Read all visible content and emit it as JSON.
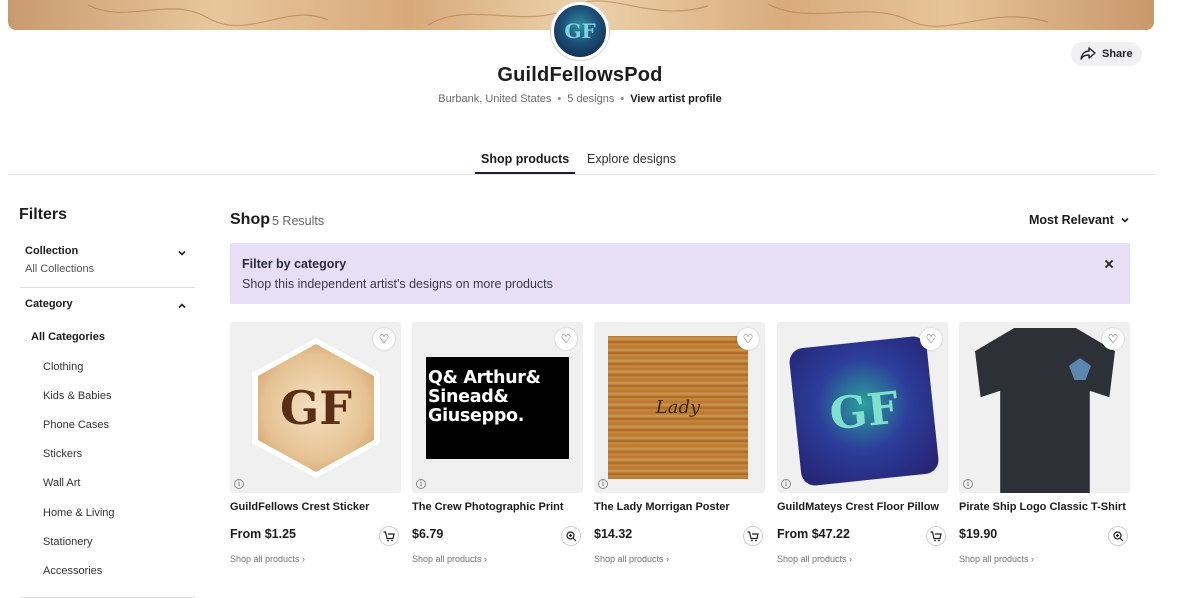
{
  "artist": {
    "name": "GuildFellowsPod",
    "location": "Burbank, United States",
    "designs_count": "5 designs",
    "view_profile": "View artist profile",
    "avatar_text": "GF"
  },
  "share": {
    "label": "Share"
  },
  "tabs": [
    {
      "label": "Shop products",
      "active": true
    },
    {
      "label": "Explore designs",
      "active": false
    }
  ],
  "filters": {
    "title": "Filters",
    "collection": {
      "label": "Collection",
      "value": "All Collections"
    },
    "category": {
      "label": "Category",
      "all": "All Categories",
      "items": [
        "Clothing",
        "Kids & Babies",
        "Phone Cases",
        "Stickers",
        "Wall Art",
        "Home & Living",
        "Stationery",
        "Accessories"
      ]
    }
  },
  "shop": {
    "title": "Shop",
    "results": "5 Results",
    "sort": "Most Relevant"
  },
  "promo": {
    "title": "Filter by category",
    "text": "Shop this independent artist's designs on more products"
  },
  "products": [
    {
      "title": "GuildFellows Crest Sticker",
      "price": "From $1.25",
      "link": "Shop all products",
      "action": "add-to-cart",
      "art_text": "GF"
    },
    {
      "title": "The Crew Photographic Print",
      "price": "$6.79",
      "link": "Shop all products",
      "action": "zoom",
      "art_text": "Q& Arthur& Sinead& Giuseppo."
    },
    {
      "title": "The Lady Morrigan Poster",
      "price": "$14.32",
      "link": "Shop all products",
      "action": "add-to-cart",
      "art_text": "Lady"
    },
    {
      "title": "GuildMateys Crest Floor Pillow",
      "price": "From $47.22",
      "link": "Shop all products",
      "action": "add-to-cart",
      "art_text": "GF"
    },
    {
      "title": "Pirate Ship Logo Classic T-Shirt",
      "price": "$19.90",
      "link": "Shop all products",
      "action": "zoom"
    }
  ],
  "colors": {
    "accent": "#1c1c3c",
    "promo_bg": "#e6dff6",
    "text": "#1c1c1c"
  }
}
